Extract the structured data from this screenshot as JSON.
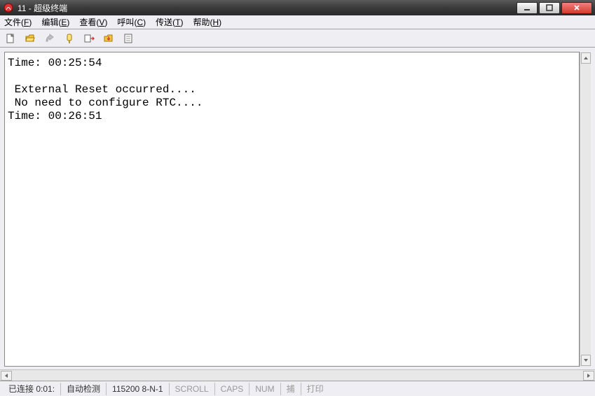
{
  "window": {
    "title": "11 - 超级终端"
  },
  "menu": {
    "file": {
      "label": "文件",
      "accel": "F"
    },
    "edit": {
      "label": "编辑",
      "accel": "E"
    },
    "view": {
      "label": "查看",
      "accel": "V"
    },
    "call": {
      "label": "呼叫",
      "accel": "C"
    },
    "transfer": {
      "label": "传送",
      "accel": "T"
    },
    "help": {
      "label": "帮助",
      "accel": "H"
    }
  },
  "toolbar": {
    "new": "new-icon",
    "open": "open-icon",
    "connect": "connect-icon",
    "disconnect": "disconnect-icon",
    "send": "send-icon",
    "receive": "receive-icon",
    "properties": "properties-icon"
  },
  "terminal": {
    "lines": [
      "Time: 00:25:54",
      "",
      " External Reset occurred....",
      " No need to configure RTC....",
      "Time: 00:26:51"
    ]
  },
  "status": {
    "conn": "已连接 0:01:",
    "detect": "自动检测",
    "baud": "115200 8-N-1",
    "scroll": "SCROLL",
    "caps": "CAPS",
    "num": "NUM",
    "capture": "捕",
    "print": "打印"
  }
}
